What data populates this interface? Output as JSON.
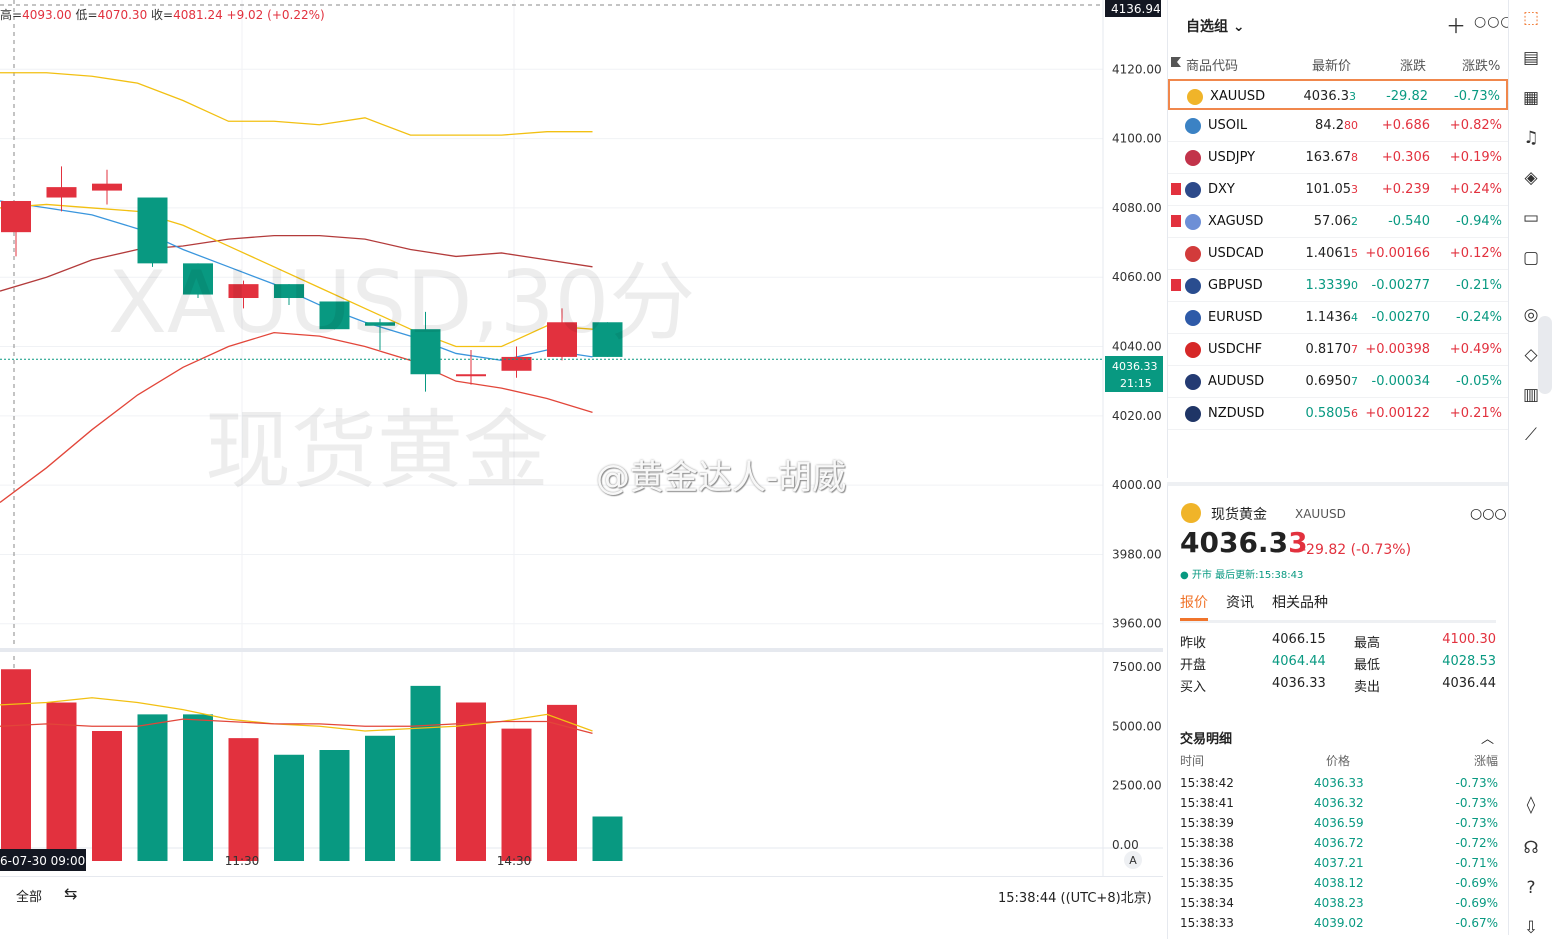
{
  "ohlc": {
    "high_label": "高=",
    "high": "4093.00",
    "low_label": "低=",
    "low": "4070.30",
    "close_label": "收=",
    "close": "4081.24",
    "change": "+9.02 (+0.22%)"
  },
  "watermark": {
    "line1": "XAUUSD,30分",
    "line2": "现货黄金"
  },
  "weibo_mark": "@黄金达人-胡威",
  "chart": {
    "top_price_tag": "4136.94",
    "current_price_tag": "4036.33",
    "countdown_tag": "21:15",
    "price_ticks": [
      "4120.00",
      "4100.00",
      "4080.00",
      "4060.00",
      "4040.00",
      "4020.00",
      "4000.00",
      "3980.00",
      "3960.00"
    ],
    "volume_ticks": [
      "7500.00",
      "5000.00",
      "2500.00",
      "0.00"
    ],
    "time_labels": [
      "6-07-30  09:00",
      "11:30",
      "14:30"
    ],
    "auto_button": "A"
  },
  "chart_data": {
    "type": "candlestick",
    "price_ylim": [
      3953,
      4140
    ],
    "candles": [
      {
        "o": 4073,
        "h": 4082,
        "l": 4066,
        "c": 4082
      },
      {
        "o": 4083,
        "h": 4092,
        "l": 4079,
        "c": 4086
      },
      {
        "o": 4085,
        "h": 4091,
        "l": 4081,
        "c": 4087
      },
      {
        "o": 4083,
        "h": 4083,
        "l": 4063,
        "c": 4064
      },
      {
        "o": 4064,
        "h": 4064,
        "l": 4054,
        "c": 4055
      },
      {
        "o": 4054,
        "h": 4059,
        "l": 4051,
        "c": 4058
      },
      {
        "o": 4058,
        "h": 4058,
        "l": 4052,
        "c": 4054
      },
      {
        "o": 4053,
        "h": 4053,
        "l": 4045,
        "c": 4045
      },
      {
        "o": 4047,
        "h": 4048,
        "l": 4039,
        "c": 4046
      },
      {
        "o": 4045,
        "h": 4050,
        "l": 4027,
        "c": 4032
      },
      {
        "o": 4032,
        "h": 4039,
        "l": 4029,
        "c": 4032
      },
      {
        "o": 4033,
        "h": 4040,
        "l": 4031,
        "c": 4037
      },
      {
        "o": 4037,
        "h": 4051,
        "l": 4036,
        "c": 4047
      },
      {
        "o": 4047,
        "h": 4047,
        "l": 4037,
        "c": 4037
      }
    ],
    "ma_yellow": [
      4119,
      4119,
      4118,
      4116,
      4111,
      4105,
      4105,
      4104,
      4106,
      4101,
      4101,
      4101,
      4102,
      4102
    ],
    "ma_red_upper": [
      4056,
      4060,
      4065,
      4068,
      4069,
      4071,
      4072,
      4072,
      4071,
      4068,
      4066,
      4067,
      4065,
      4063
    ],
    "ma_red_lower": [
      3995,
      4005,
      4016,
      4026,
      4034,
      4040,
      4044,
      4043,
      4040,
      4036,
      4030,
      4028,
      4025,
      4021
    ],
    "ma_blue": [
      4082,
      4080,
      4078,
      4074,
      4068,
      4063,
      4058,
      4052,
      4047,
      4043,
      4038,
      4036,
      4039,
      4037
    ],
    "ma_orange": [
      4080,
      4081,
      4080,
      4079,
      4075,
      4069,
      4063,
      4057,
      4051,
      4045,
      4040,
      4040,
      4046,
      4045
    ],
    "volume_ylim": [
      0,
      8000
    ],
    "volumes": [
      7400,
      6000,
      4800,
      5500,
      5500,
      4500,
      3800,
      4000,
      4600,
      6700,
      6000,
      4900,
      5900,
      1200
    ],
    "vol_ma_yellow": [
      5900,
      6000,
      6200,
      6000,
      5700,
      5300,
      5100,
      5000,
      4800,
      4900,
      5000,
      5200,
      5500,
      4800
    ],
    "vol_ma_red": [
      5000,
      5100,
      5000,
      5000,
      5300,
      5200,
      5100,
      5100,
      5000,
      5000,
      5100,
      5200,
      5200,
      4700
    ]
  },
  "bottom_bar": {
    "range_label": "全部",
    "clock": "15:38:44 ((UTC+8)北京)"
  },
  "watchlist": {
    "title": "自选组",
    "headers": [
      "商品代码",
      "最新价",
      "涨跌",
      "涨跌%"
    ],
    "rows": [
      {
        "sym": "XAUUSD",
        "price": "4036.3",
        "last": "3",
        "chg": "-29.82",
        "pct": "-0.73%",
        "dir": "dn",
        "flag": false,
        "icon": "#f0b429",
        "price_color": "blk",
        "selected": true
      },
      {
        "sym": "USOIL",
        "price": "84.2",
        "last": "80",
        "chg": "+0.686",
        "pct": "+0.82%",
        "dir": "up",
        "flag": false,
        "icon": "#3b82c4",
        "price_color": "blk"
      },
      {
        "sym": "USDJPY",
        "price": "163.67",
        "last": "8",
        "chg": "+0.306",
        "pct": "+0.19%",
        "dir": "up",
        "flag": false,
        "icon": "#c2334a",
        "price_color": "blk"
      },
      {
        "sym": "DXY",
        "price": "101.05",
        "last": "3",
        "chg": "+0.239",
        "pct": "+0.24%",
        "dir": "up",
        "flag": true,
        "icon": "#2d4a8a",
        "price_color": "blk"
      },
      {
        "sym": "XAGUSD",
        "price": "57.06",
        "last": "2",
        "chg": "-0.540",
        "pct": "-0.94%",
        "dir": "dn",
        "flag": true,
        "icon": "#6d8fd6",
        "price_color": "blk"
      },
      {
        "sym": "USDCAD",
        "price": "1.4061",
        "last": "5",
        "chg": "+0.00166",
        "pct": "+0.12%",
        "dir": "up",
        "flag": false,
        "icon": "#d23b3b",
        "price_color": "blk"
      },
      {
        "sym": "GBPUSD",
        "price": "1.3339",
        "last": "0",
        "chg": "-0.00277",
        "pct": "-0.21%",
        "dir": "dn",
        "flag": true,
        "icon": "#2a4d8f",
        "price_color": "dn"
      },
      {
        "sym": "EURUSD",
        "price": "1.1436",
        "last": "4",
        "chg": "-0.00270",
        "pct": "-0.24%",
        "dir": "dn",
        "flag": false,
        "icon": "#2e5aa8",
        "price_color": "blk"
      },
      {
        "sym": "USDCHF",
        "price": "0.8170",
        "last": "7",
        "chg": "+0.00398",
        "pct": "+0.49%",
        "dir": "up",
        "flag": false,
        "icon": "#d62828",
        "price_color": "blk"
      },
      {
        "sym": "AUDUSD",
        "price": "0.6950",
        "last": "7",
        "chg": "-0.00034",
        "pct": "-0.05%",
        "dir": "dn",
        "flag": false,
        "icon": "#243b73",
        "price_color": "blk"
      },
      {
        "sym": "NZDUSD",
        "price": "0.5805",
        "last": "6",
        "chg": "+0.00122",
        "pct": "+0.21%",
        "dir": "up",
        "flag": false,
        "icon": "#1f3566",
        "price_color": "dn"
      }
    ]
  },
  "detail": {
    "name": "现货黄金",
    "symbol": "XAUUSD",
    "price_main": "4036.3",
    "price_last": "3",
    "change": "-29.82 (-0.73%)",
    "status": "● 开市 最后更新:15:38:43",
    "tabs": [
      "报价",
      "资讯",
      "相关品种"
    ],
    "quotes": [
      {
        "l1": "昨收",
        "v1": "4066.15",
        "c1": "blk",
        "l2": "最高",
        "v2": "4100.30",
        "c2": "up"
      },
      {
        "l1": "开盘",
        "v1": "4064.44",
        "c1": "dn",
        "l2": "最低",
        "v2": "4028.53",
        "c2": "dn"
      },
      {
        "l1": "买入",
        "v1": "4036.33",
        "c1": "blk",
        "l2": "卖出",
        "v2": "4036.44",
        "c2": "blk"
      }
    ],
    "trades_title": "交易明细",
    "trades_headers": [
      "时间",
      "价格",
      "涨幅"
    ],
    "trades": [
      {
        "t": "15:38:42",
        "p": "4036.33",
        "c": "-0.73%"
      },
      {
        "t": "15:38:41",
        "p": "4036.32",
        "c": "-0.73%"
      },
      {
        "t": "15:38:39",
        "p": "4036.59",
        "c": "-0.73%"
      },
      {
        "t": "15:38:38",
        "p": "4036.72",
        "c": "-0.72%"
      },
      {
        "t": "15:38:36",
        "p": "4037.21",
        "c": "-0.71%"
      },
      {
        "t": "15:38:35",
        "p": "4038.12",
        "c": "-0.69%"
      },
      {
        "t": "15:38:34",
        "p": "4038.23",
        "c": "-0.69%"
      },
      {
        "t": "15:38:33",
        "p": "4039.02",
        "c": "-0.67%"
      }
    ]
  },
  "colors": {
    "up": "#e2313e",
    "down": "#089981",
    "accent": "#f0742b"
  },
  "sidebar_icons": [
    "watchlist-icon",
    "news-icon",
    "calendar-icon",
    "alert-icon",
    "layers-icon",
    "video-icon",
    "chat-icon",
    "target-icon",
    "education-icon",
    "table-icon",
    "strategy-icon",
    "handshake-icon",
    "support-icon",
    "help-icon",
    "download-icon"
  ]
}
